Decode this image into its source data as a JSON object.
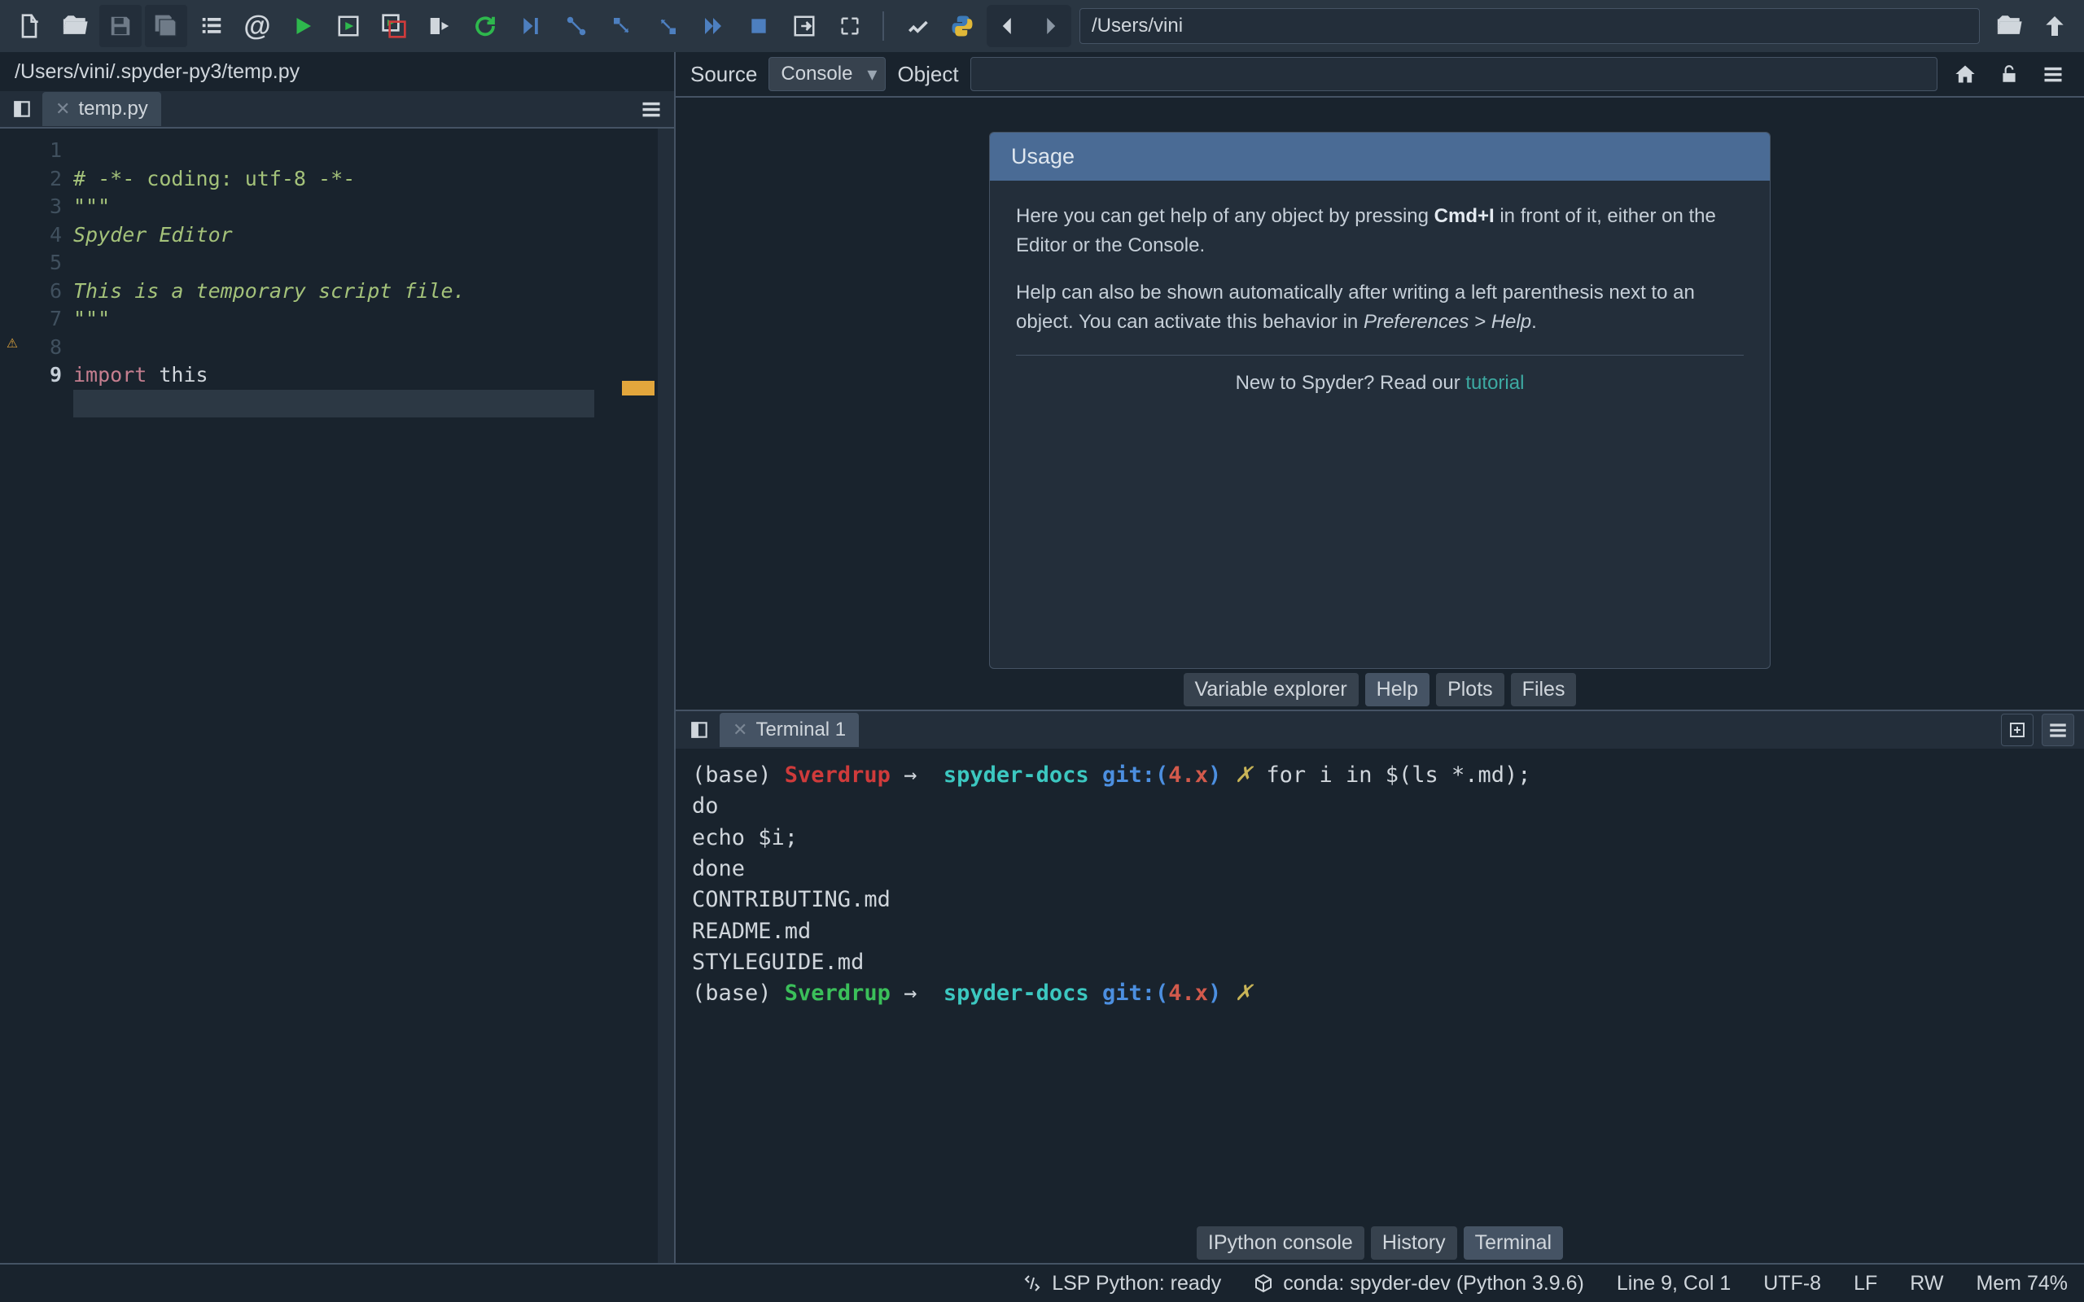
{
  "toolbar": {
    "path_value": "/Users/vini"
  },
  "breadcrumb": "/Users/vini/.spyder-py3/temp.py",
  "editor": {
    "tab_name": "temp.py",
    "lines": {
      "l1": "# -*- coding: utf-8 -*-",
      "l2": "\"\"\"",
      "l3": "Spyder Editor",
      "l4": "",
      "l5": "This is a temporary script file.",
      "l6": "\"\"\"",
      "l7": "",
      "l8_kw": "import",
      "l8_rest": " this",
      "l9": ""
    },
    "line_numbers": [
      "1",
      "2",
      "3",
      "4",
      "5",
      "6",
      "7",
      "8",
      "9"
    ]
  },
  "help": {
    "source_label": "Source",
    "console_option": "Console",
    "object_label": "Object",
    "usage_title": "Usage",
    "p1_a": "Here you can get help of any object by pressing ",
    "p1_b": "Cmd+I",
    "p1_c": " in front of it, either on the Editor or the Console.",
    "p2_a": "Help can also be shown automatically after writing a left parenthesis next to an object. You can activate this behavior in ",
    "p2_b": "Preferences > Help",
    "p2_c": ".",
    "tut_a": "New to Spyder? Read our ",
    "tut_link": "tutorial",
    "tabs": {
      "ve": "Variable explorer",
      "help": "Help",
      "plots": "Plots",
      "files": "Files"
    }
  },
  "terminal": {
    "tab_name": "Terminal 1",
    "prompt1": {
      "base": "(base) ",
      "host": "Sverdrup",
      "arrow": " → ",
      "dir": " spyder-docs ",
      "git": "git:(",
      "branch": "4.x",
      "git2": ")",
      "x": " ✗ ",
      "cmd": "for i in $(ls *.md);"
    },
    "body_lines": [
      "do",
      "echo $i;",
      "done",
      "CONTRIBUTING.md",
      "README.md",
      "STYLEGUIDE.md"
    ],
    "prompt2": {
      "base": "(base) ",
      "host": "Sverdrup",
      "arrow": " → ",
      "dir": " spyder-docs ",
      "git": "git:(",
      "branch": "4.x",
      "git2": ")",
      "x": " ✗ "
    },
    "tabs": {
      "ipy": "IPython console",
      "hist": "History",
      "term": "Terminal"
    }
  },
  "status": {
    "lsp": "LSP Python: ready",
    "env": "conda: spyder-dev (Python 3.9.6)",
    "pos": "Line 9, Col 1",
    "enc": "UTF-8",
    "eol": "LF",
    "rw": "RW",
    "mem": "Mem 74%"
  }
}
